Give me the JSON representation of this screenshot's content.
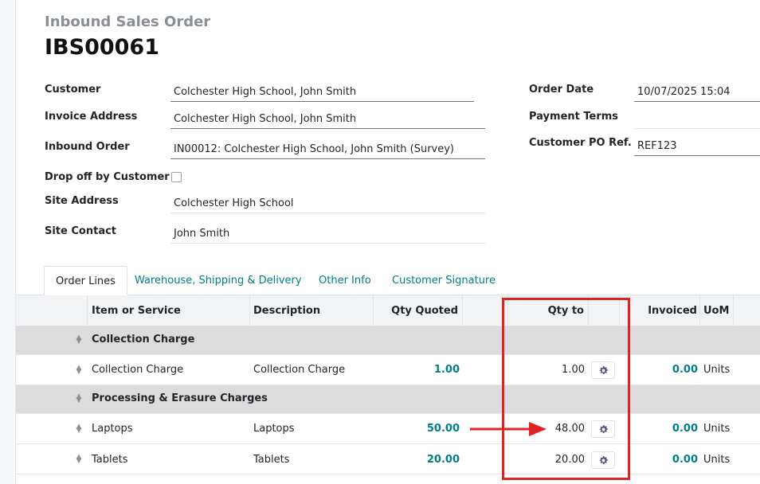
{
  "header": {
    "subtitle": "Inbound Sales Order",
    "title": "IBS00061"
  },
  "fields": {
    "customer_label": "Customer",
    "customer_value": "Colchester High School, John Smith",
    "invoice_address_label": "Invoice Address",
    "invoice_address_value": "Colchester High School, John Smith",
    "inbound_order_label": "Inbound Order",
    "inbound_order_value": "IN00012: Colchester High School, John Smith (Survey)",
    "drop_off_label": "Drop off by Customer",
    "site_address_label": "Site Address",
    "site_address_value": "Colchester High School",
    "site_contact_label": "Site Contact",
    "site_contact_value": "John Smith",
    "order_date_label": "Order Date",
    "order_date_value": "10/07/2025 15:04",
    "payment_terms_label": "Payment Terms",
    "payment_terms_value": "",
    "customer_po_label": "Customer PO Ref.",
    "customer_po_value": "REF123"
  },
  "tabs": [
    "Order Lines",
    "Warehouse, Shipping & Delivery",
    "Other Info",
    "Customer Signature"
  ],
  "table": {
    "columns": {
      "item": "Item or Service",
      "description": "Description",
      "qty_quoted": "Qty Quoted",
      "qty_to_invoice": "Qty to Invoice",
      "invoiced": "Invoiced",
      "uom": "UoM"
    },
    "sections": [
      {
        "name": "Collection Charge",
        "lines": [
          {
            "item": "Collection Charge",
            "description": "Collection Charge",
            "qty_quoted": "1.00",
            "qty_to_invoice": "1.00",
            "invoiced": "0.00",
            "uom": "Units"
          }
        ]
      },
      {
        "name": "Processing & Erasure Charges",
        "lines": [
          {
            "item": "Laptops",
            "description": "Laptops",
            "qty_quoted": "50.00",
            "qty_to_invoice": "48.00",
            "invoiced": "0.00",
            "uom": "Units"
          },
          {
            "item": "Tablets",
            "description": "Tablets",
            "qty_quoted": "20.00",
            "qty_to_invoice": "20.00",
            "invoiced": "0.00",
            "uom": "Units"
          }
        ]
      }
    ]
  },
  "colors": {
    "accent": "#017e84",
    "highlight": "#e02323",
    "gear": "#5b4a82"
  },
  "icons": {
    "row_handle": "drag-handle-icon",
    "row_action": "gear-icon",
    "annotation": "arrow-right-icon"
  }
}
